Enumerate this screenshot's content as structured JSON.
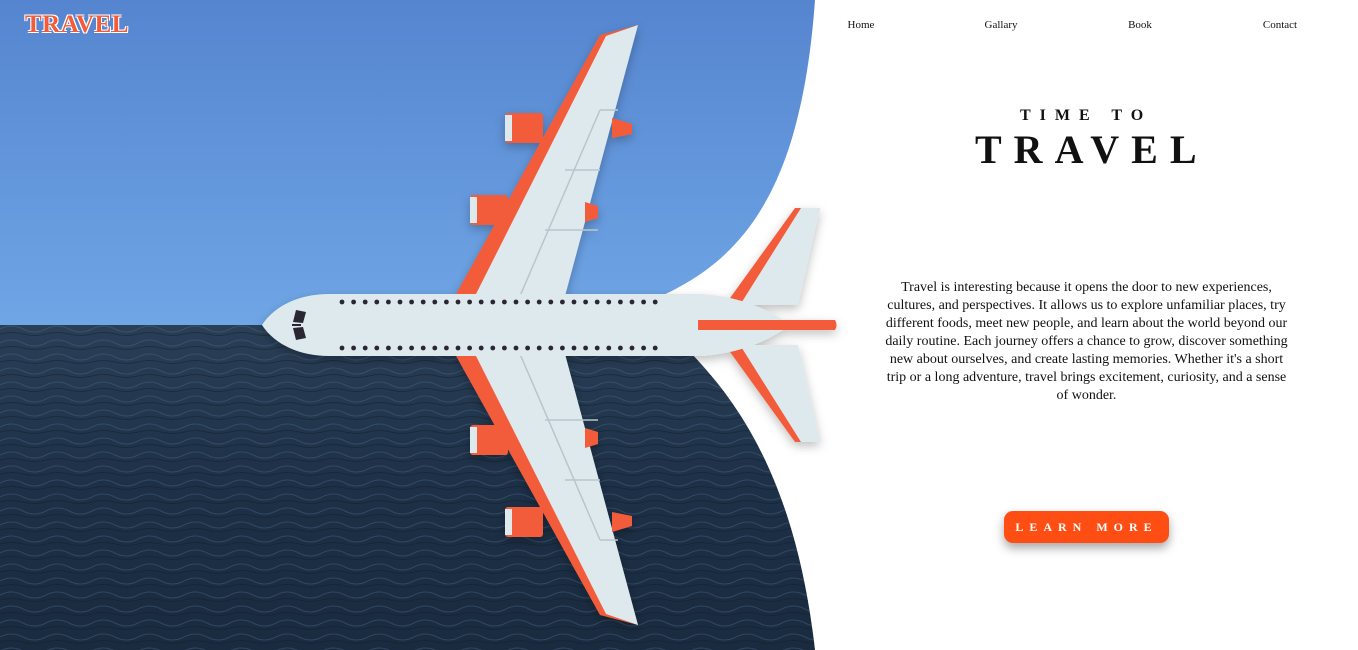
{
  "brand": {
    "logo_text": "TRAVEL"
  },
  "nav": {
    "items": [
      "Home",
      "Gallary",
      "Book",
      "Contact"
    ]
  },
  "hero": {
    "subtitle": "TIME TO",
    "title": "TRAVEL",
    "description": "Travel is interesting because it opens the door to new experiences, cultures, and perspectives. It allows us to explore unfamiliar places, try different foods, meet new people, and learn about the world beyond our daily routine. Each journey offers a chance to grow, discover something new about ourselves, and create lasting memories. Whether it's a short trip or a long adventure, travel brings excitement, curiosity, and a sense of wonder.",
    "cta_label": "LEARN MORE"
  },
  "colors": {
    "accent": "#ff4e14",
    "plane_accent": "#f25c3a",
    "plane_body": "#dde9ec",
    "sky": "#5b8fd2",
    "sea": "#1c2f45"
  },
  "icons": {
    "hero_illustration": "airplane-icon"
  }
}
